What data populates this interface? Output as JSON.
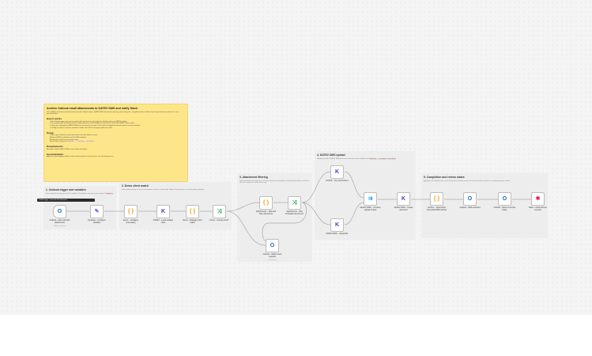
{
  "main_note": {
    "title": "Archive Outlook email attachments to DATEV DMS and notify Slack",
    "intro": "This workflow archives email attachments from the Outlook inbox in DATEV DMS, detects the matching client and posts a completion notice to Slack. Each step marks the email so it is never processed twice.",
    "how_heading": "How it works",
    "how_items": [
      "1. An Outlook trigger picks up new emails with attachments and applies the template with your DATEV settings.",
      "2. The attachments are filtered and the sender domain is matched against a list of clients to find the DATEV client number.",
      "3. Each file is uploaded to DATEV DMS and a document is created, or the email is flagged for manual review if no client matched.",
      "4. Finally the email is archived, moved to a folder and a Slack message reports the result."
    ],
    "setup_heading": "Setup",
    "setup_items": [
      "Connect your Outlook account and choose the inbox folder to watch.",
      "Add your DATEV credentials and the DMS endpoint.",
      "Maintain the client list in the demo nodes.",
      "Set the Slack channel in",
      "Template – Configure variables"
    ],
    "req_heading": "Requirements",
    "req_text": "Microsoft Outlook, DATEV DMS access, Slack workspace.",
    "custom_heading": "Customization",
    "custom_text": "Adjust the client mapping, folder names and message text to match your own archiving process."
  },
  "tooltip": "Outlook trigger – new mail with attachment",
  "sections": [
    {
      "title": "1. Outlook trigger and variables",
      "text": "New emails with attachments start the workflow. The template node stores your settings in",
      "code": "Template"
    },
    {
      "title": "2. Demo client match",
      "text": "Demo nodes simulate a client list and compare it with the email sender. Replace them with your own lookup before going live.",
      "code": ""
    },
    {
      "title": "3. Attachment filtering",
      "text": "Split attachments into single items and keep only files that should be archived. Emails without a matched client are routed to a manual review step.",
      "code": ""
    },
    {
      "title": "4. DATEV DMS upload",
      "text": "Uploads each file to DATEV DMS and creates a document with metadata from",
      "code": "Template – Configure variables"
    },
    {
      "title": "5. Completion and review states",
      "text": "Aggregates the upload results, marks the email as archived, moves it to the archive folder and posts a summary message to Slack.",
      "code": ""
    }
  ],
  "nodes": [
    {
      "id": "n1",
      "label": "Outlook – New mail with attachments",
      "sub": "Polling every minute",
      "icon": "outlook-icon",
      "glyph": "O",
      "color": "#0f6cbd"
    },
    {
      "id": "n2",
      "label": "Template – Configure variables",
      "sub": "",
      "icon": "pencil-icon",
      "glyph": "✎",
      "color": "#6366f1"
    },
    {
      "id": "n3",
      "label": "Demo – Configure processing",
      "sub": "",
      "icon": "code-braces-icon",
      "glyph": "{ }",
      "color": "#f59e0b"
    },
    {
      "id": "n4",
      "label": "DATEV – Load updates client",
      "sub": "",
      "icon": "datev-k-icon",
      "glyph": "K",
      "color": "#4338ca"
    },
    {
      "id": "n5",
      "label": "Demo – Evaluate client match",
      "sub": "",
      "icon": "code-braces-icon",
      "glyph": "{ }",
      "color": "#f59e0b"
    },
    {
      "id": "n6",
      "label": "Demo – Known client?",
      "sub": "",
      "icon": "if-branch-icon",
      "glyph": "⤨",
      "color": "#16a34a"
    },
    {
      "id": "n7",
      "label": "Attachments – Split and filter documents",
      "sub": "",
      "icon": "code-braces-icon",
      "glyph": "{ }",
      "color": "#f59e0b"
    },
    {
      "id": "n8",
      "label": "Attachments – Has archivable document?",
      "sub": "",
      "icon": "if-branch-icon",
      "glyph": "⤨",
      "color": "#16a34a"
    },
    {
      "id": "n9",
      "label": "Outlook – Mark review required",
      "sub": "manual review",
      "icon": "outlook-icon",
      "glyph": "O",
      "color": "#0f6cbd"
    },
    {
      "id": "n10",
      "label": "DATEV – Get user/context",
      "sub": "",
      "icon": "datev-k-icon",
      "glyph": "K",
      "color": "#4338ca"
    },
    {
      "id": "n11",
      "label": "DATEV DMS – Upload file",
      "sub": "",
      "icon": "datev-k-icon",
      "glyph": "K",
      "color": "#4338ca"
    },
    {
      "id": "n12",
      "label": "Add DV DMS – Combine upload context",
      "sub": "",
      "icon": "merge-icon",
      "glyph": "⇉",
      "color": "#0ea5e9"
    },
    {
      "id": "n13",
      "label": "DATEV DMS – Create document",
      "sub": "",
      "icon": "datev-k-icon",
      "glyph": "K",
      "color": "#4338ca"
    },
    {
      "id": "n14",
      "label": "Archive – Summarize successful DMS archive",
      "sub": "",
      "icon": "code-braces-icon",
      "glyph": "{ }",
      "color": "#f59e0b"
    },
    {
      "id": "n15",
      "label": "Outlook – Mark archived",
      "sub": "",
      "icon": "outlook-icon",
      "glyph": "O",
      "color": "#0f6cbd"
    },
    {
      "id": "n16",
      "label": "Outlook – Move to archive folder",
      "sub": "",
      "icon": "outlook-icon",
      "glyph": "O",
      "color": "#0f6cbd"
    },
    {
      "id": "n17",
      "label": "Slack – Notify archive success",
      "sub": "",
      "icon": "slack-icon",
      "glyph": "✱",
      "color": "#e01e5a"
    }
  ]
}
